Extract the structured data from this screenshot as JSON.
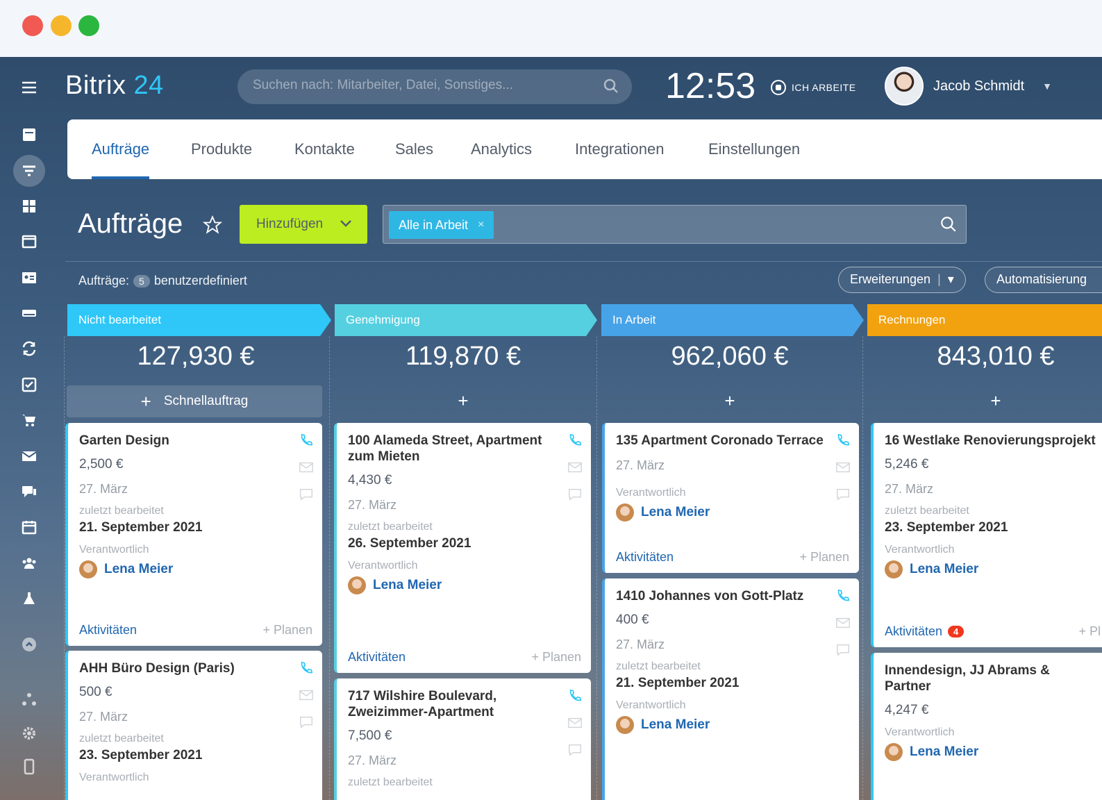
{
  "brand": {
    "name": "Bitrix",
    "number": "24"
  },
  "header": {
    "search_placeholder": "Suchen nach: Mitarbeiter, Datei, Sonstiges...",
    "time": "12:53",
    "work_status": "ICH ARBEITE",
    "user_name": "Jacob Schmidt"
  },
  "tabs": [
    "Aufträge",
    "Produkte",
    "Kontakte",
    "Sales",
    "Analytics",
    "Integrationen",
    "Einstellungen"
  ],
  "toolbar": {
    "title": "Aufträge",
    "add_label": "Hinzufügen",
    "filter_chip": "Alle in Arbeit",
    "chip_close": "×",
    "counter_label": "Aufträge:",
    "counter_value": "5",
    "counter_suffix": "benutzerdefiniert",
    "extensions_label": "Erweiterungen",
    "automation_label": "Automatisierung"
  },
  "colors": {
    "accent": "#2067b0",
    "add_button": "#bbed21",
    "chip": "#2fb7e4",
    "notification": "#f0371f"
  },
  "columns": [
    {
      "title": "Nicht bearbeitet",
      "sum": "127,930 €",
      "color": "#2fc7f7",
      "quick_label": "Schnellauftrag"
    },
    {
      "title": "Genehmigung",
      "sum": "119,870 €",
      "color": "#55d0e0"
    },
    {
      "title": "In Arbeit",
      "sum": "962,060 €",
      "color": "#47a3e8"
    },
    {
      "title": "Rechnungen",
      "sum": "843,010 €",
      "color": "#f1a20e"
    }
  ],
  "plus": "+",
  "labels": {
    "last_edited": "zuletzt bearbeitet",
    "responsible": "Verantwortlich",
    "activities": "Aktivitäten",
    "plan": "+ Planen"
  },
  "cards": [
    {
      "title": "Garten Design",
      "amount": "2,500 €",
      "date": "27. März",
      "edited": "21. September 2021",
      "person": "Lena Meier"
    },
    {
      "title": "AHH Büro Design (Paris)",
      "amount": "500 €",
      "date": "27. März",
      "edited": "23. September 2021"
    },
    {
      "title": "100 Alameda Street, Apartment zum Mieten",
      "amount": "4,430 €",
      "date": "27. März",
      "edited": "26. September 2021",
      "person": "Lena Meier"
    },
    {
      "title": "717 Wilshire Boulevard, Zweizimmer-Apartment",
      "amount": "7,500 €",
      "date": "27. März"
    },
    {
      "title": "135 Apartment Coronado Terrace",
      "date": "27. März",
      "person": "Lena Meier"
    },
    {
      "title": "1410 Johannes von Gott-Platz",
      "amount": "400 €",
      "date": "27. März",
      "edited": "21. September 2021",
      "person": "Lena Meier"
    },
    {
      "title": "16 Westlake Renovierungsprojekt",
      "amount": "5,246 €",
      "date": "27. März",
      "edited": "23. September 2021",
      "person": "Lena Meier",
      "activity_count": "4",
      "plan_partial": "+ Pl"
    },
    {
      "title": "Innendesign, JJ Abrams & Partner",
      "amount": "4,247 €",
      "person": "Lena Meier"
    }
  ]
}
